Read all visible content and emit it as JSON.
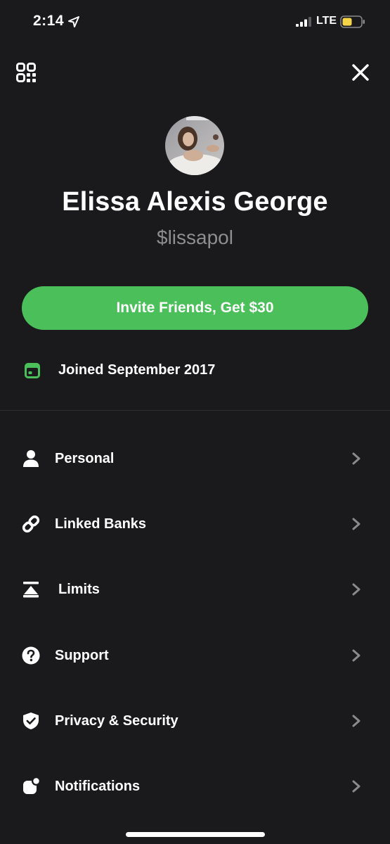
{
  "status_bar": {
    "time": "2:14",
    "network": "LTE",
    "icons": [
      "location-arrow-icon",
      "signal-icon",
      "battery-icon"
    ],
    "battery_color": "#f5d547"
  },
  "header": {
    "left_icon": "qr-code-icon",
    "right_icon": "close-icon"
  },
  "profile": {
    "name": "Elissa Alexis George",
    "cashtag": "$lissapol"
  },
  "invite": {
    "label": "Invite Friends, Get $30",
    "color": "#4bbf5a"
  },
  "joined": {
    "text": "Joined September 2017",
    "icon": "calendar-icon"
  },
  "menu": {
    "items": [
      {
        "label": "Personal",
        "icon": "person-icon"
      },
      {
        "label": "Linked Banks",
        "icon": "link-icon"
      },
      {
        "label": "Limits",
        "icon": "limits-icon"
      },
      {
        "label": "Support",
        "icon": "question-icon"
      },
      {
        "label": "Privacy & Security",
        "icon": "shield-icon"
      },
      {
        "label": "Notifications",
        "icon": "notification-icon"
      }
    ]
  },
  "colors": {
    "background": "#1a1a1c",
    "accent": "#4bbf5a",
    "secondary_text": "#8d8d92",
    "chevron": "#8a8a8e"
  }
}
